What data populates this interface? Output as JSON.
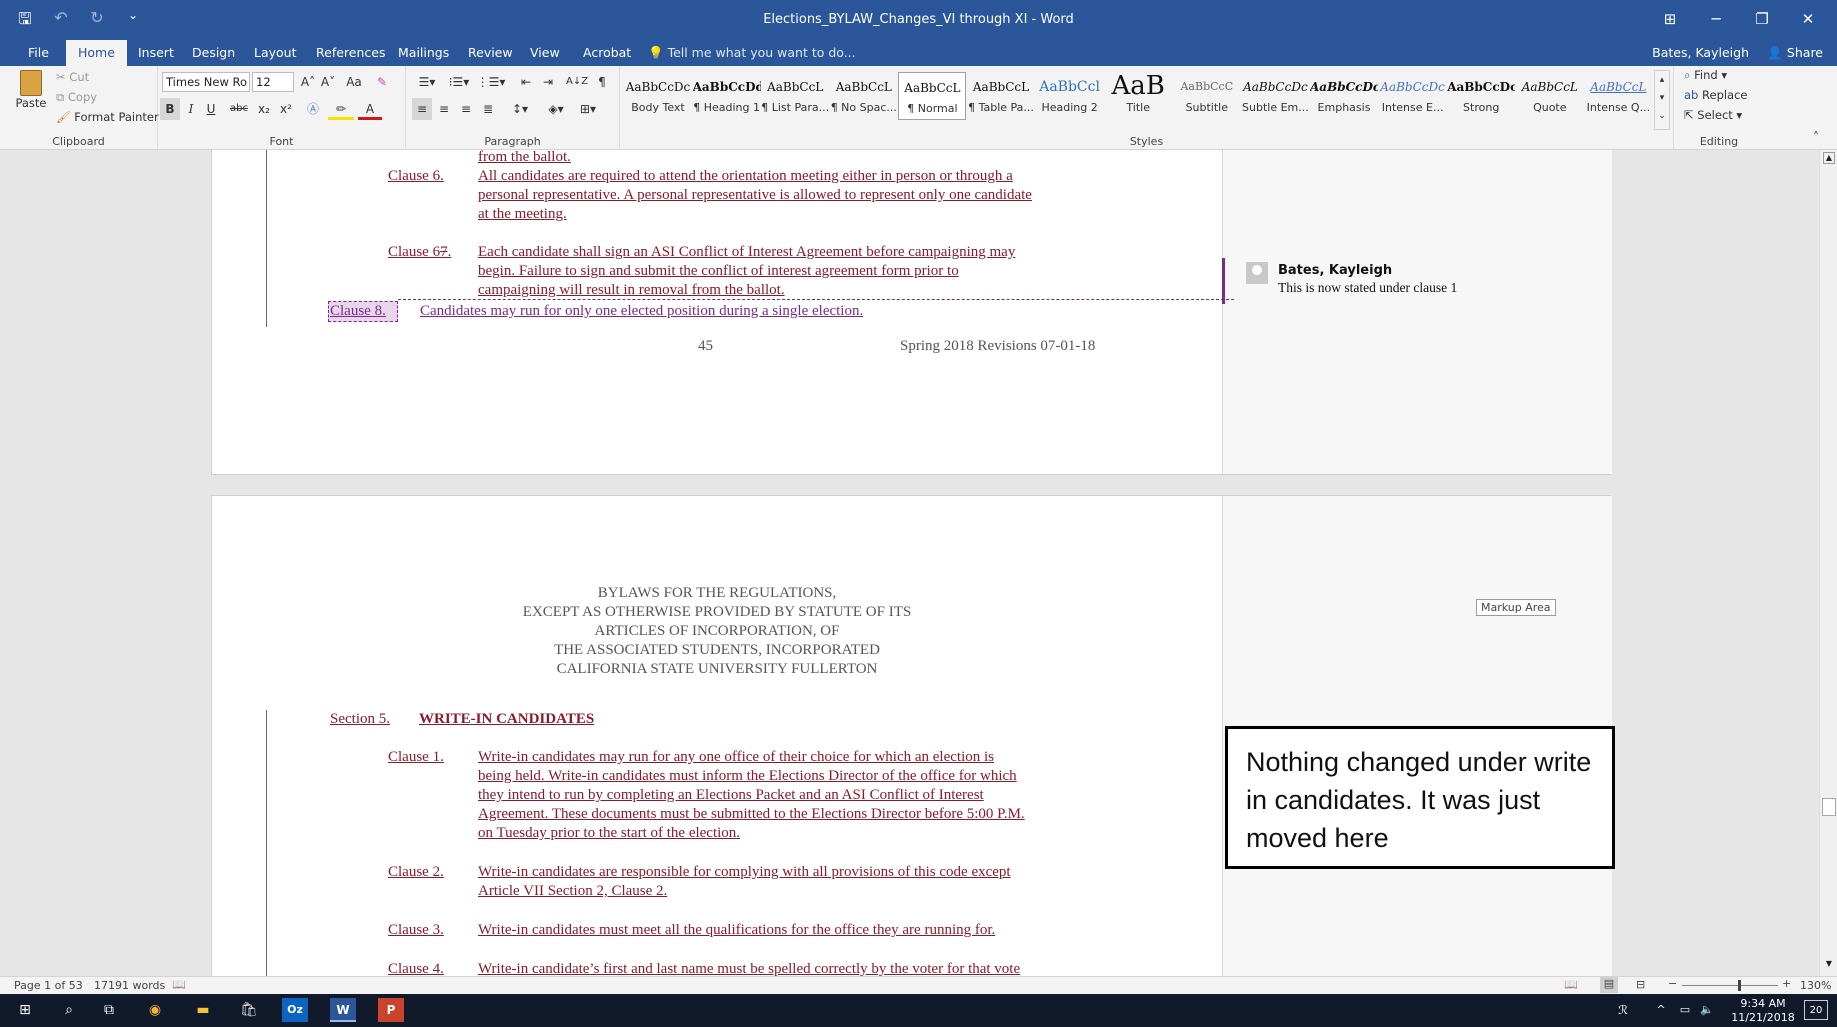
{
  "window": {
    "title": "Elections_BYLAW_Changes_VI through XI - Word",
    "qat_save": "🖫",
    "qat_undo": "↶",
    "qat_redo": "↻",
    "qat_more": "⌄",
    "ctl_ribbon": "⊞",
    "ctl_min": "─",
    "ctl_max": "❐",
    "ctl_close": "✕"
  },
  "tabs": {
    "file": "File",
    "home": "Home",
    "insert": "Insert",
    "design": "Design",
    "layout": "Layout",
    "references": "References",
    "mailings": "Mailings",
    "review": "Review",
    "view": "View",
    "acrobat": "Acrobat",
    "tellme": "Tell me what you want to do...",
    "user": "Bates, Kayleigh",
    "share": "Share"
  },
  "ribbon": {
    "clipboard": {
      "label": "Clipboard",
      "paste": "Paste",
      "cut": "Cut",
      "copy": "Copy",
      "format_painter": "Format Painter"
    },
    "font": {
      "label": "Font",
      "family": "Times New Ro",
      "size": "12",
      "grow": "A˄",
      "shrink": "A˅",
      "case": "Aa",
      "bold": "B",
      "italic": "I",
      "underline": "U",
      "strike": "abc",
      "subscript": "x₂",
      "superscript": "x²",
      "color": "A"
    },
    "paragraph": {
      "label": "Paragraph",
      "sort": "A↓Z",
      "pilcrow": "¶"
    },
    "styles": {
      "label": "Styles",
      "items": [
        {
          "sample": "AaBbCcDc",
          "name": "Body Text"
        },
        {
          "sample": "AaBbCcDd",
          "name": "¶ Heading 1"
        },
        {
          "sample": "AaBbCcL",
          "name": "¶ List Para..."
        },
        {
          "sample": "AaBbCcL",
          "name": "¶ No Spac..."
        },
        {
          "sample": "AaBbCcL",
          "name": "¶ Normal"
        },
        {
          "sample": "AaBbCcL",
          "name": "¶ Table Pa..."
        },
        {
          "sample": "AaBbCcl",
          "name": "Heading 2"
        },
        {
          "sample": "AaB",
          "name": "Title"
        },
        {
          "sample": "AaBbCcC",
          "name": "Subtitle"
        },
        {
          "sample": "AaBbCcDc",
          "name": "Subtle Em..."
        },
        {
          "sample": "AaBbCcDc",
          "name": "Emphasis"
        },
        {
          "sample": "AaBbCcDc",
          "name": "Intense E..."
        },
        {
          "sample": "AaBbCcDc",
          "name": "Strong"
        },
        {
          "sample": "AaBbCcL",
          "name": "Quote"
        },
        {
          "sample": "AaBbCcL",
          "name": "Intense Q..."
        }
      ]
    },
    "editing": {
      "label": "Editing",
      "find": "Find",
      "replace": "Replace",
      "select": "Select"
    }
  },
  "page1": {
    "line_top": "from the ballot.",
    "clause6_num": "Clause 6.",
    "clause6_l1": "All candidates are required to attend the orientation meeting either in person or through a",
    "clause6_l2": "personal representative. A personal representative is allowed to represent only one candidate",
    "clause6_l3": "at the meeting.",
    "clause7_num_a": "Clause 6",
    "clause7_num_b": "7",
    "clause7_num_c": ".",
    "clause7_l1": "Each candidate shall sign an ASI Conflict of Interest Agreement before campaigning may",
    "clause7_l2": "begin. Failure to sign and submit the conflict of interest agreement form prior to",
    "clause7_l3": "campaigning will result in removal from the ballot.",
    "clause8_num": "Clause 8.",
    "clause8_text": "Candidates may run for only one elected position during a single election.",
    "page_number": "45",
    "footer_revisions": "Spring 2018 Revisions 07-01-18",
    "comment_author": "Bates, Kayleigh",
    "comment_text": "This is now stated under clause 1"
  },
  "page2": {
    "header_lines": [
      "BYLAWS FOR THE REGULATIONS,",
      "EXCEPT AS OTHERWISE PROVIDED BY STATUTE OF ITS",
      "ARTICLES OF INCORPORATION, OF",
      "THE ASSOCIATED STUDENTS, INCORPORATED",
      "CALIFORNIA STATE UNIVERSITY FULLERTON"
    ],
    "section_num": "Section 5.",
    "section_title": "WRITE-IN CANDIDATES",
    "c1_num": "Clause 1.",
    "c1_lines": [
      "Write-in candidates may run for any one office of their choice for which an election is",
      "being held. Write-in candidates must inform the Elections Director of the office for which",
      "they intend to run by completing an Elections Packet and an ASI Conflict of Interest",
      "Agreement. These documents must be submitted to the Elections Director before 5:00 P.M.",
      "on Tuesday prior to the start of the election."
    ],
    "c2_num": "Clause 2.",
    "c2_lines": [
      "Write-in candidates are responsible for complying with all provisions of this code except",
      "Article VII Section 2, Clause 2."
    ],
    "c3_num": "Clause 3.",
    "c3_lines": [
      "Write-in candidates must meet all the qualifications for the office they are running for."
    ],
    "c4_num": "Clause 4.",
    "c4_lines": [
      "Write-in candidate’s first and last name must be spelled correctly by the voter for that vote"
    ],
    "markup_tooltip": "Markup Area",
    "note_text": "Nothing changed under write in candidates. It was just moved here"
  },
  "status": {
    "page": "Page 1 of 53",
    "words": "17191 words",
    "zoom": "130%",
    "zoom_level_pct": 58
  },
  "taskbar": {
    "time": "9:34 AM",
    "date": "11/21/2018",
    "notif_count": "20"
  },
  "colors": {
    "title_bar": "#2b579a",
    "revision_text": "#8b1a2a",
    "comment_line": "#7b2a8b"
  }
}
